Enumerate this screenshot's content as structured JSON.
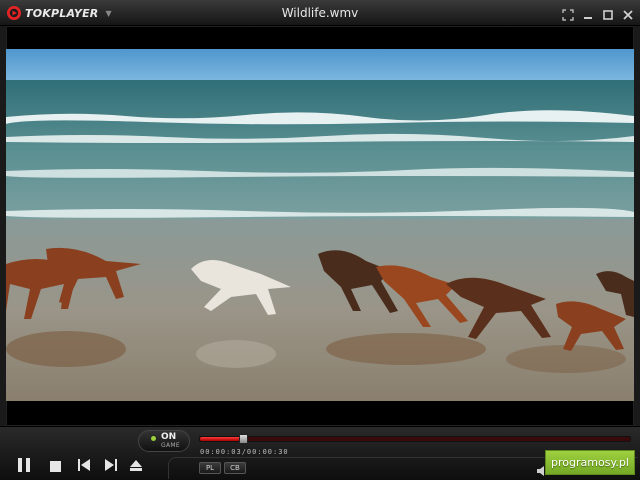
{
  "app": {
    "logo_text": "TOKPLAYER",
    "window_title": "Wildlife.wmv"
  },
  "window_controls": [
    "fullscreen-icon",
    "minimize-icon",
    "maximize-icon",
    "close-icon"
  ],
  "colors": {
    "accent": "#d21a1a",
    "logo_red": "#e12323",
    "on_indicator": "#9ccf3a",
    "brand_green": "#8cc33a"
  },
  "player": {
    "on_label": "ON",
    "game_label": "GAME",
    "timecode": "00:00:03/00:00:30",
    "progress": 0.1,
    "playlist_label": "PL",
    "cb_label": "CB"
  },
  "controls": [
    "pause-icon",
    "stop-icon",
    "previous-icon",
    "next-icon",
    "eject-icon",
    "volume-icon"
  ],
  "watermark": {
    "text": "programosy.pl"
  }
}
